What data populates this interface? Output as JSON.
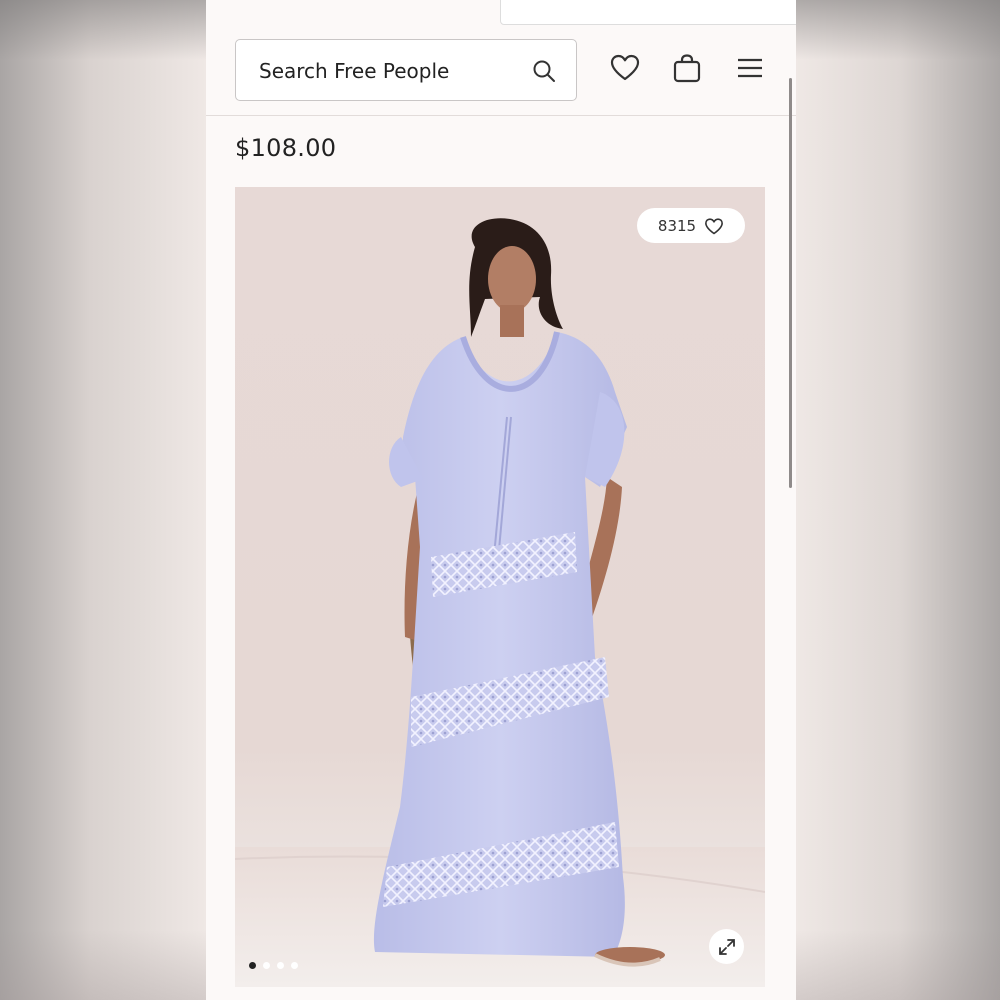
{
  "search": {
    "placeholder": "Search Free People",
    "icon": "search-icon"
  },
  "header_icons": {
    "wishlist": "heart-icon",
    "bag": "shopping-bag-icon",
    "menu": "hamburger-menu-icon"
  },
  "product": {
    "price": "$108.00"
  },
  "gallery": {
    "like_count": "8315",
    "slide_count": 4,
    "active_slide": 1,
    "expand_icon": "expand-icon"
  },
  "colors": {
    "dress": "#c7cbee",
    "background": "#e7d9d6",
    "page": "#fcf9f8"
  }
}
